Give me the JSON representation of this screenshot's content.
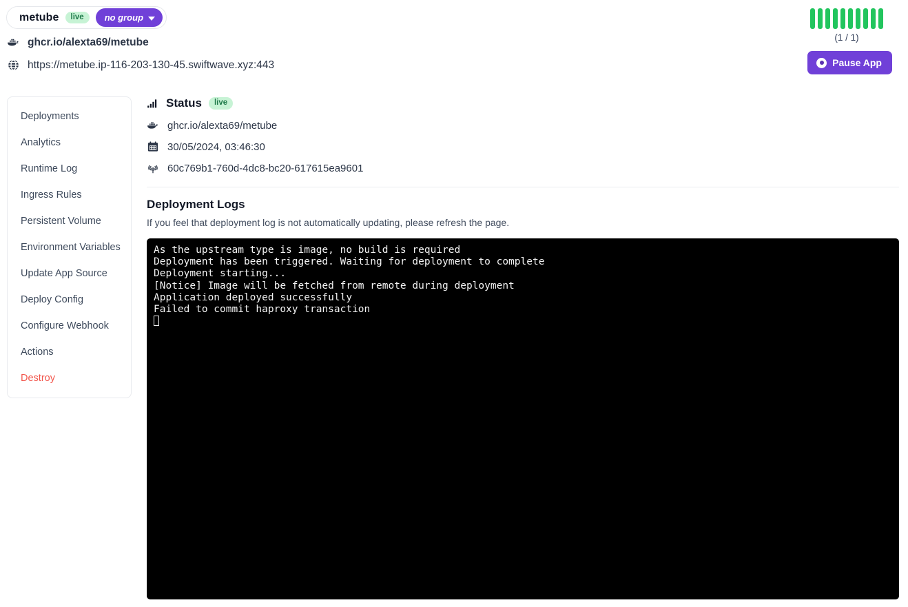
{
  "header": {
    "app_name": "metube",
    "live_badge": "live",
    "group_label": "no group",
    "image_ref": "ghcr.io/alexta69/metube",
    "url": "https://metube.ip-116-203-130-45.swiftwave.xyz:443",
    "replica_count_label": "(1 / 1)",
    "replica_bars": 10,
    "replica_bar_color": "#22c55e",
    "pause_button_label": "Pause App",
    "accent_color": "#7040d8",
    "live_badge_bg": "#c7f3d5",
    "live_badge_fg": "#1f7a4a",
    "icons": {
      "image": "docker-whale-icon",
      "url": "globe-icon",
      "pause": "pause-circle-icon",
      "group_chevron": "chevron-down-icon"
    }
  },
  "sidebar": {
    "items": [
      {
        "label": "Deployments",
        "danger": false
      },
      {
        "label": "Analytics",
        "danger": false
      },
      {
        "label": "Runtime Log",
        "danger": false
      },
      {
        "label": "Ingress Rules",
        "danger": false
      },
      {
        "label": "Persistent Volume",
        "danger": false
      },
      {
        "label": "Environment Variables",
        "danger": false
      },
      {
        "label": "Update App Source",
        "danger": false
      },
      {
        "label": "Deploy Config",
        "danger": false
      },
      {
        "label": "Configure Webhook",
        "danger": false
      },
      {
        "label": "Actions",
        "danger": false
      },
      {
        "label": "Destroy",
        "danger": true
      }
    ],
    "danger_color": "#f2564c"
  },
  "status": {
    "title": "Status",
    "live_badge": "live",
    "image_ref": "ghcr.io/alexta69/metube",
    "timestamp": "30/05/2024, 03:46:30",
    "deployment_id": "60c769b1-760d-4dc8-bc20-617615ea9601",
    "icons": {
      "title": "signal-bars-icon",
      "image": "docker-whale-icon",
      "date": "calendar-icon",
      "id": "fingerprint-icon"
    }
  },
  "logs": {
    "title": "Deployment Logs",
    "subtitle": "If you feel that deployment log is not automatically updating, please refresh the page.",
    "background": "#000000",
    "text_color": "#f2f2f2",
    "lines": [
      "As the upstream type is image, no build is required",
      "Deployment has been triggered. Waiting for deployment to complete",
      "Deployment starting...",
      "[Notice] Image will be fetched from remote during deployment",
      "Application deployed successfully",
      "Failed to commit haproxy transaction"
    ],
    "cursor_visible": true
  }
}
